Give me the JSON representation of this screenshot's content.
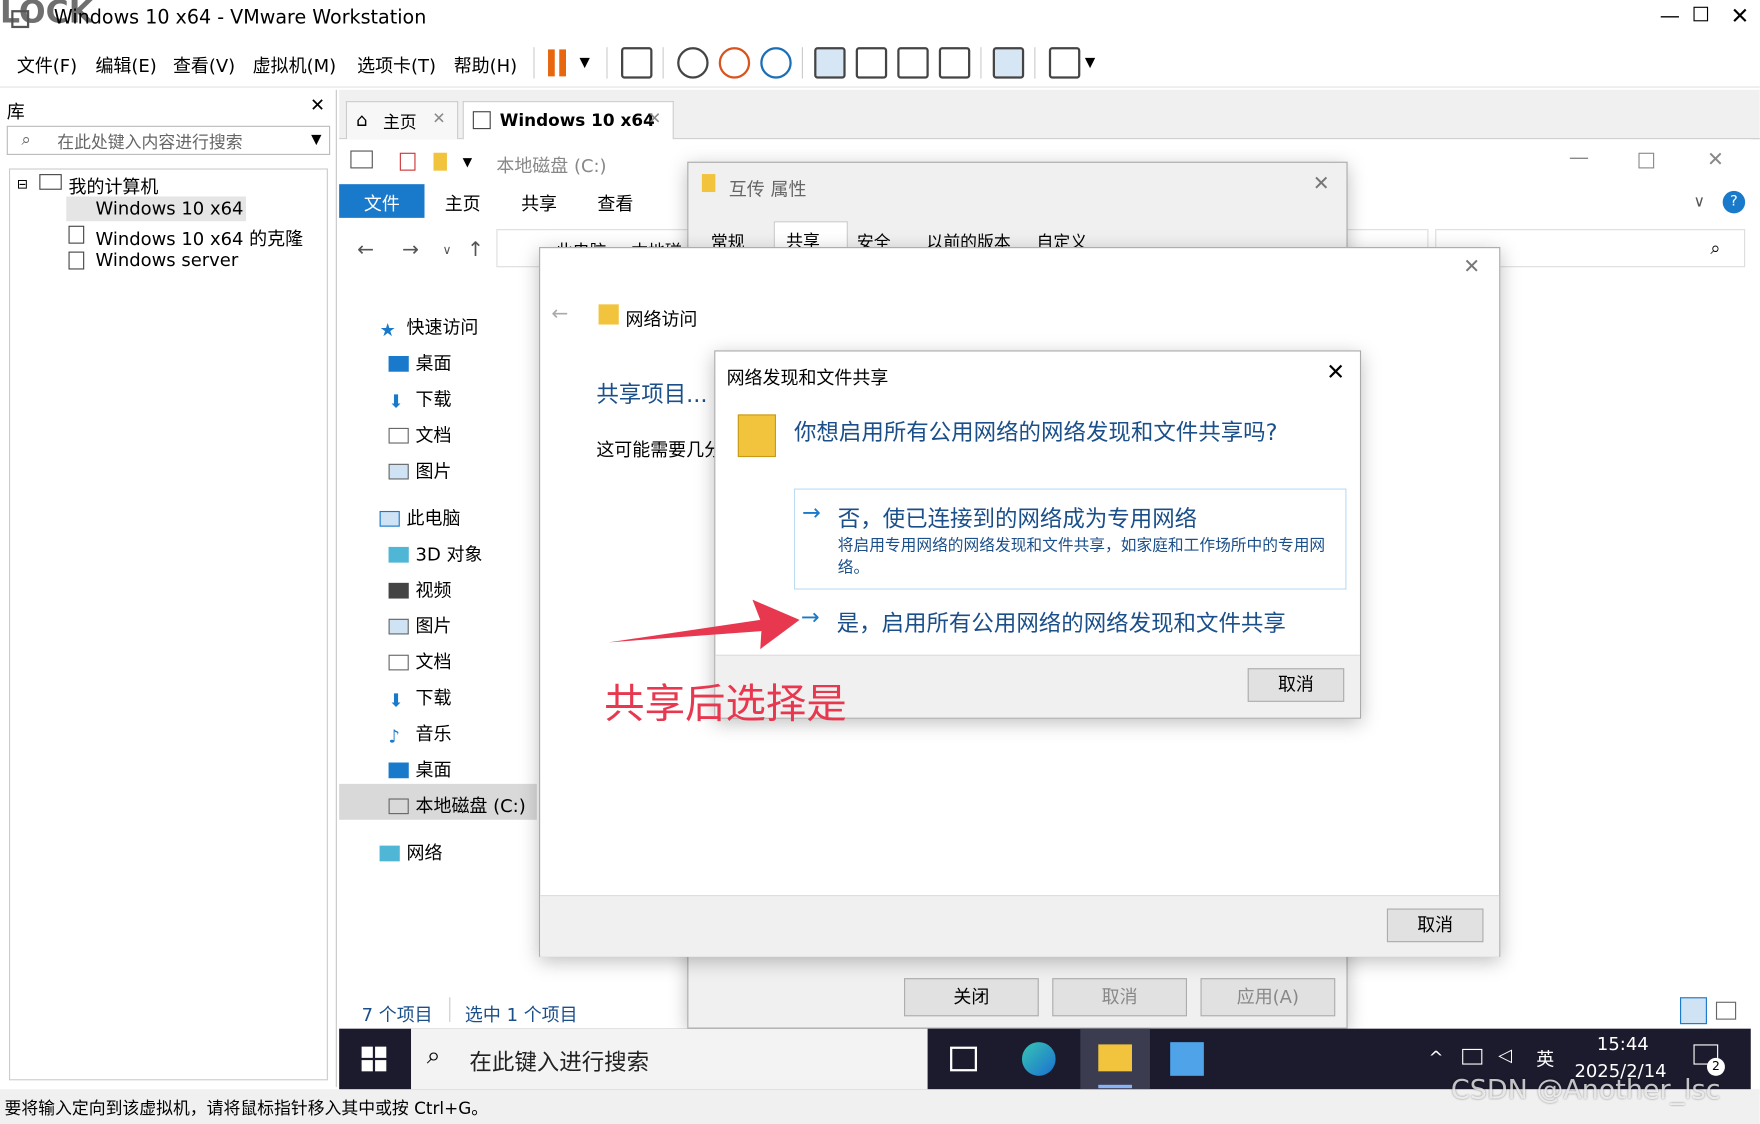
{
  "window": {
    "title": "Windows 10 x64 - VMware Workstation",
    "overlay_title": "LOCK"
  },
  "menu": [
    "文件(F)",
    "编辑(E)",
    "查看(V)",
    "虚拟机(M)",
    "选项卡(T)",
    "帮助(H)"
  ],
  "library": {
    "title": "库",
    "search_placeholder": "在此处键入内容进行搜索",
    "tree_root": "我的计算机",
    "items": [
      "Windows 10 x64",
      "Windows 10 x64 的克隆",
      "Windows server"
    ]
  },
  "tabs": [
    {
      "label": "主页"
    },
    {
      "label": "Windows 10 x64"
    }
  ],
  "explorer": {
    "title": "本地磁盘 (C:)",
    "ribbon_tabs": [
      "文件",
      "主页",
      "共享",
      "查看"
    ],
    "address": "此电脑 > 本地磁",
    "nav": [
      "快速访问",
      "桌面",
      "下载",
      "文档",
      "图片",
      "此电脑",
      "3D 对象",
      "视频",
      "图片",
      "文档",
      "下载",
      "音乐",
      "桌面",
      "本地磁盘 (C:)",
      "网络"
    ],
    "status_count": "7 个项目",
    "status_selected": "选中 1 个项目"
  },
  "properties": {
    "title": "互传 属性",
    "tabs": [
      "常规",
      "共享",
      "安全",
      "以前的版本",
      "自定义"
    ],
    "buttons": [
      "关闭",
      "取消",
      "应用(A)"
    ]
  },
  "network_access": {
    "title": "网络访问",
    "heading": "共享项目...",
    "body": "这可能需要几分",
    "cancel": "取消"
  },
  "discovery": {
    "title": "网络发现和文件共享",
    "question": "你想启用所有公用网络的网络发现和文件共享吗?",
    "option_no_title": "否，使已连接到的网络成为专用网络",
    "option_no_desc": "将启用专用网络的网络发现和文件共享，如家庭和工作场所中的专用网络。",
    "option_yes_title": "是，启用所有公用网络的网络发现和文件共享",
    "cancel": "取消"
  },
  "annotation": {
    "text": "共享后选择是",
    "color": "#e8384f"
  },
  "taskbar": {
    "search_placeholder": "在此键入进行搜索",
    "ime": "英",
    "time": "15:44",
    "date": "2025/2/14",
    "notif_count": "2"
  },
  "statusbar": {
    "text": "要将输入定向到该虚拟机，请将鼠标指针移入其中或按 Ctrl+G。",
    "watermark": "CSDN @Another_lsc"
  }
}
